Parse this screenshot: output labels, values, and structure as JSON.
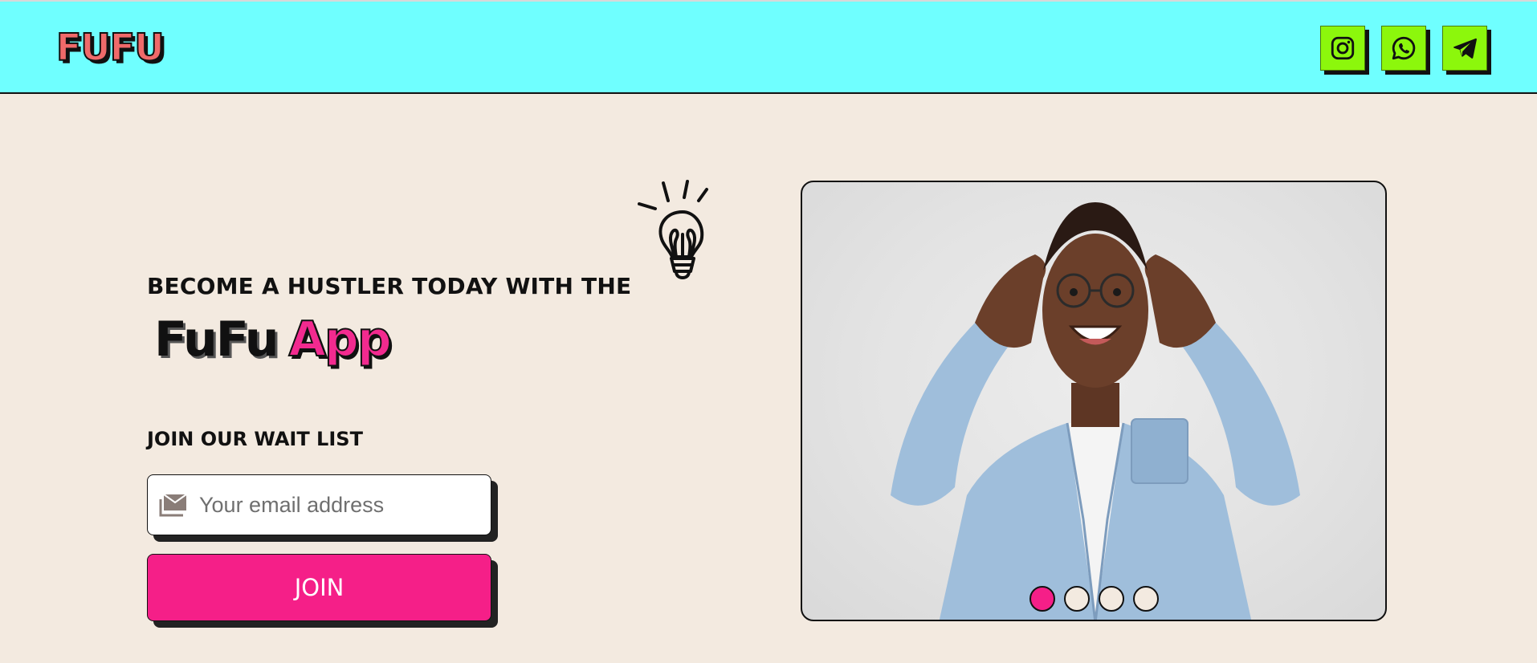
{
  "header": {
    "logo_text": "FUFU",
    "socials": [
      {
        "name": "instagram-icon"
      },
      {
        "name": "whatsapp-icon"
      },
      {
        "name": "telegram-icon"
      }
    ],
    "background": "#6fffff",
    "social_button_color": "#8cf70c"
  },
  "hero": {
    "headline": "BECOME A HUSTLER TODAY WITH THE",
    "brand_part1": "FuFu",
    "brand_part2": "App",
    "icon": "lightbulb-icon"
  },
  "waitlist": {
    "title": "JOIN OUR WAIT LIST",
    "email_placeholder": "Your email address",
    "email_value": "",
    "join_label": "JOIN",
    "accent": "#f51f88"
  },
  "carousel": {
    "image_alt": "excited man holding his head",
    "dots": 4,
    "active_index": 0
  }
}
